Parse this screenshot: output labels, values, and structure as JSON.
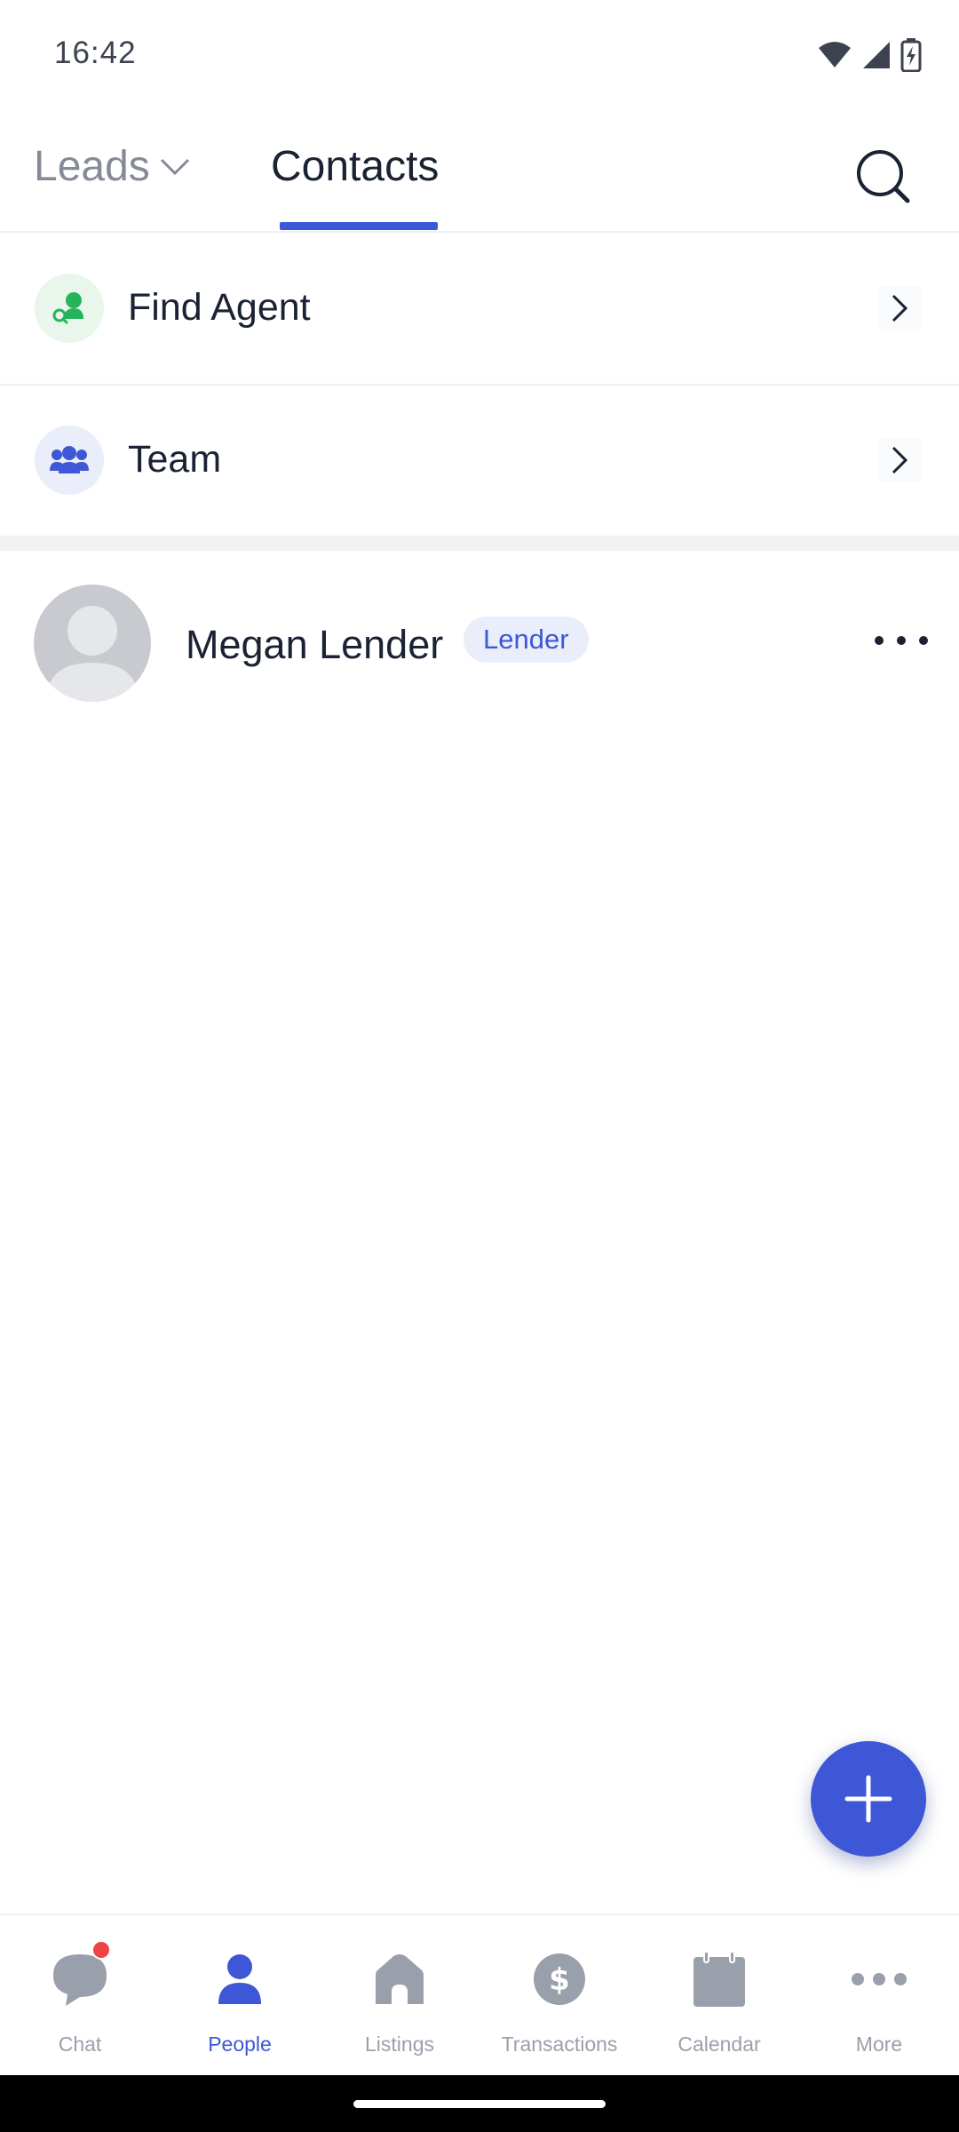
{
  "status_bar": {
    "time": "16:42"
  },
  "header": {
    "tabs": [
      {
        "label": "Leads",
        "active": false
      },
      {
        "label": "Contacts",
        "active": true
      }
    ]
  },
  "menu": {
    "items": [
      {
        "label": "Find Agent",
        "icon": "find-agent-icon"
      },
      {
        "label": "Team",
        "icon": "team-icon"
      }
    ]
  },
  "contacts": [
    {
      "name": "Megan Lender",
      "role_badge": "Lender"
    }
  ],
  "bottom_nav": {
    "items": [
      {
        "label": "Chat",
        "icon": "chat-icon",
        "has_notification": true
      },
      {
        "label": "People",
        "icon": "person-icon",
        "active": true
      },
      {
        "label": "Listings",
        "icon": "house-icon"
      },
      {
        "label": "Transactions",
        "icon": "dollar-icon"
      },
      {
        "label": "Calendar",
        "icon": "calendar-icon"
      },
      {
        "label": "More",
        "icon": "more-horizontal-icon"
      }
    ]
  },
  "colors": {
    "accent": "#3d57d6",
    "inactive": "#9aa0ab",
    "text": "#1a2233",
    "find_agent_green": "#27b35a",
    "notification_red": "#ee4444"
  }
}
